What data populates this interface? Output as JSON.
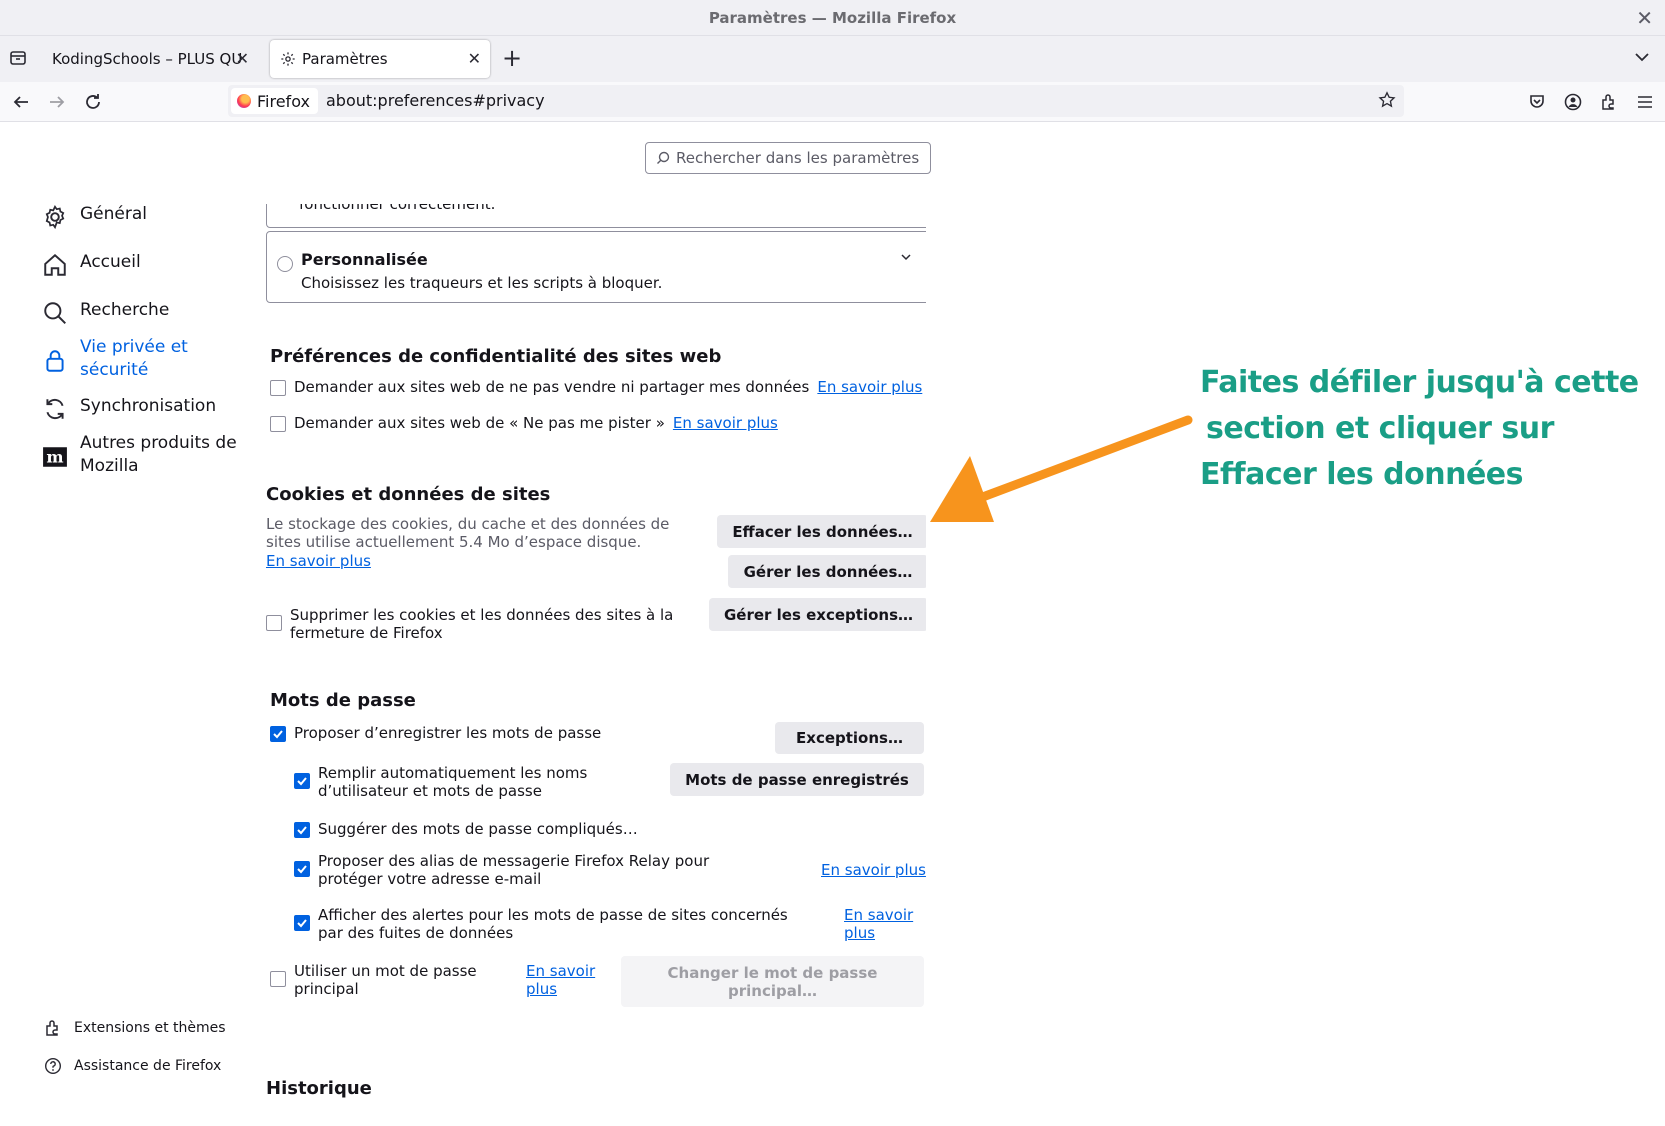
{
  "window": {
    "title": "Paramètres — Mozilla Firefox"
  },
  "tabs": [
    {
      "label": "KodingSchools – PLUS QUE"
    },
    {
      "label": "Paramètres"
    }
  ],
  "navbar": {
    "identity_label": "Firefox",
    "url": "about:preferences#privacy"
  },
  "search": {
    "placeholder": "Rechercher dans les paramètres"
  },
  "sidebar": {
    "items": [
      {
        "label": "Général",
        "icon": "gear-icon"
      },
      {
        "label": "Accueil",
        "icon": "home-icon"
      },
      {
        "label": "Recherche",
        "icon": "search-icon"
      },
      {
        "label": "Vie privée et sécurité",
        "icon": "lock-icon",
        "active": true
      },
      {
        "label": "Synchronisation",
        "icon": "sync-icon"
      },
      {
        "label": "Autres produits de Mozilla",
        "icon": "mozilla-icon"
      }
    ],
    "footer": [
      {
        "label": "Extensions et thèmes",
        "icon": "puzzle-icon"
      },
      {
        "label": "Assistance de Firefox",
        "icon": "help-icon"
      }
    ]
  },
  "tracking": {
    "partial_text": "fonctionner correctement.",
    "custom_title": "Personnalisée",
    "custom_desc": "Choisissez les traqueurs et les scripts à bloquer."
  },
  "privacy_prefs": {
    "heading": "Préférences de confidentialité des sites web",
    "items": [
      {
        "label": "Demander aux sites web de ne pas vendre ni partager mes données",
        "checked": false,
        "link": "En savoir plus"
      },
      {
        "label": "Demander aux sites web de « Ne pas me pister »",
        "checked": false,
        "link": "En savoir plus"
      }
    ]
  },
  "cookies": {
    "heading": "Cookies et données de sites",
    "desc": "Le stockage des cookies, du cache et des données de sites utilise actuellement 5.4 Mo d’espace disque.",
    "link": "En savoir plus",
    "clear_button": "Effacer les données…",
    "manage_button": "Gérer les données…",
    "exceptions_button": "Gérer les exceptions…",
    "delete_on_close": "Supprimer les cookies et les données des sites à la fermeture de Firefox"
  },
  "passwords": {
    "heading": "Mots de passe",
    "ask_save": "Proposer d’enregistrer les mots de passe",
    "exceptions_button": "Exceptions…",
    "autofill": "Remplir automatiquement les noms d’utilisateur et mots de passe",
    "saved_button": "Mots de passe enregistrés",
    "suggest": "Suggérer des mots de passe compliqués…",
    "relay": "Proposer des alias de messagerie Firefox Relay pour protéger votre adresse e-mail",
    "relay_link": "En savoir plus",
    "breach": "Afficher des alertes pour les mots de passe de sites concernés par des fuites de données",
    "breach_link": "En savoir plus",
    "primary": "Utiliser un mot de passe principal",
    "primary_link": "En savoir plus",
    "change_primary_button": "Changer le mot de passe principal…"
  },
  "history": {
    "heading": "Historique"
  },
  "annotation": {
    "lines": [
      "Faites défiler jusqu'à cette",
      "section et cliquer sur",
      "Effacer les données"
    ],
    "color": "#1a9e86",
    "arrow_color": "#f7941d"
  }
}
